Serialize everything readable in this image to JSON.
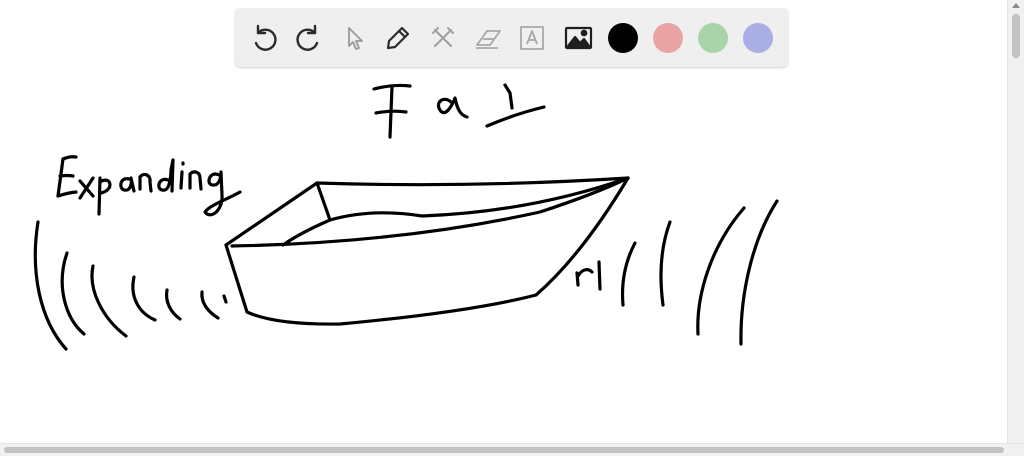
{
  "toolbar": {
    "tools": [
      {
        "name": "undo-icon"
      },
      {
        "name": "redo-icon"
      },
      {
        "name": "select-pointer-icon"
      },
      {
        "name": "pen-icon"
      },
      {
        "name": "tools-crossed-icon"
      },
      {
        "name": "eraser-icon"
      },
      {
        "name": "text-tool-icon"
      },
      {
        "name": "image-icon"
      }
    ],
    "colors": [
      "#000000",
      "#e9a3a3",
      "#a9d3a9",
      "#a9aee4"
    ]
  },
  "drawing": {
    "ink_color": "#000000",
    "handwritten_text": [
      "F",
      "∝",
      "1",
      "Expanding",
      "r1"
    ]
  }
}
